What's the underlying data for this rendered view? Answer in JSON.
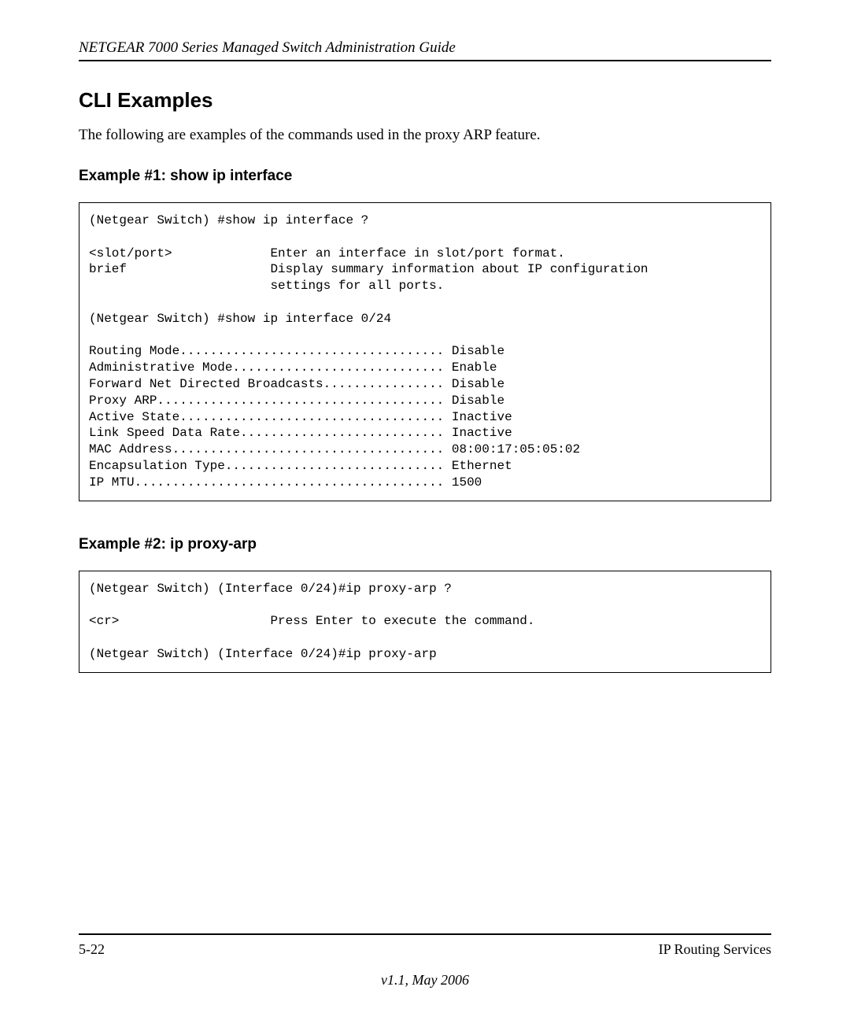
{
  "header": {
    "title": "NETGEAR 7000  Series Managed Switch Administration Guide"
  },
  "section": {
    "title": "CLI Examples",
    "intro": "The following are examples of the commands used in the proxy ARP feature."
  },
  "example1": {
    "title": "Example #1: show ip interface",
    "code": "(Netgear Switch) #show ip interface ?\n\n<slot/port>             Enter an interface in slot/port format.\nbrief                   Display summary information about IP configuration\n                        settings for all ports.\n\n(Netgear Switch) #show ip interface 0/24\n\nRouting Mode................................... Disable\nAdministrative Mode............................ Enable\nForward Net Directed Broadcasts................ Disable\nProxy ARP...................................... Disable\nActive State................................... Inactive\nLink Speed Data Rate........................... Inactive\nMAC Address.................................... 08:00:17:05:05:02\nEncapsulation Type............................. Ethernet\nIP MTU......................................... 1500\n"
  },
  "example2": {
    "title": "Example #2: ip proxy-arp",
    "code": "(Netgear Switch) (Interface 0/24)#ip proxy-arp ?\n\n<cr>                    Press Enter to execute the command.\n\n(Netgear Switch) (Interface 0/24)#ip proxy-arp"
  },
  "footer": {
    "pagenum": "5-22",
    "section": "IP Routing Services",
    "version": "v1.1, May 2006"
  }
}
